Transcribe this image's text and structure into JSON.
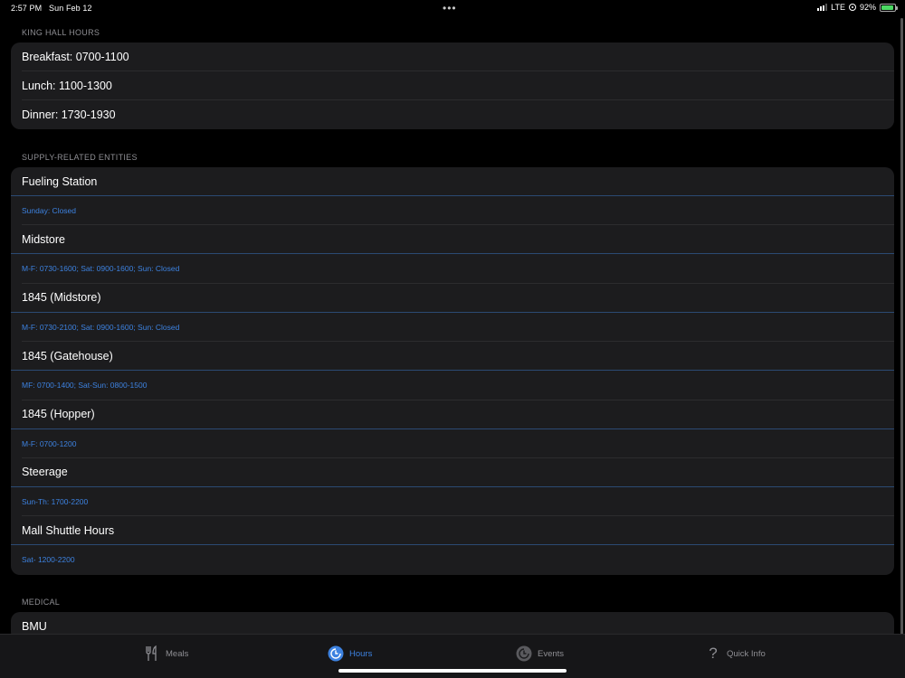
{
  "status_bar": {
    "time": "2:57 PM",
    "date": "Sun Feb 12",
    "network": "LTE",
    "battery": "92%",
    "battery_level": 0.92
  },
  "sections": {
    "king_hall": {
      "header": "KING HALL HOURS",
      "rows": [
        "Breakfast: 0700-1100",
        "Lunch: 1100-1300",
        "Dinner: 1730-1930"
      ]
    },
    "supply": {
      "header": "SUPPLY-RELATED ENTITIES",
      "entities": [
        {
          "name": "Fueling Station",
          "hours": "Sunday: Closed"
        },
        {
          "name": "Midstore",
          "hours": "M-F: 0730-1600; Sat: 0900-1600; Sun: Closed"
        },
        {
          "name": "1845 (Midstore)",
          "hours": "M-F: 0730-2100; Sat: 0900-1600; Sun: Closed"
        },
        {
          "name": "1845 (Gatehouse)",
          "hours": "MF: 0700-1400; Sat-Sun: 0800-1500"
        },
        {
          "name": "1845 (Hopper)",
          "hours": "M-F: 0700-1200"
        },
        {
          "name": "Steerage",
          "hours": "Sun-Th: 1700-2200"
        },
        {
          "name": "Mall Shuttle Hours",
          "hours": "Sat- 1200-2200"
        }
      ]
    },
    "medical": {
      "header": "MEDICAL",
      "rows": [
        "BMU"
      ]
    }
  },
  "tab_bar": {
    "tabs": [
      {
        "label": "Meals",
        "icon": "fork-knife-icon",
        "active": false
      },
      {
        "label": "Hours",
        "icon": "clock-icon",
        "active": true
      },
      {
        "label": "Events",
        "icon": "clock-outline-icon",
        "active": false
      },
      {
        "label": "Quick Info",
        "icon": "question-mark-icon",
        "active": false
      }
    ]
  },
  "colors": {
    "accent": "#3d82e0",
    "background": "#000000",
    "cell": "#1c1c1e",
    "secondary_text": "#8e8e93"
  }
}
